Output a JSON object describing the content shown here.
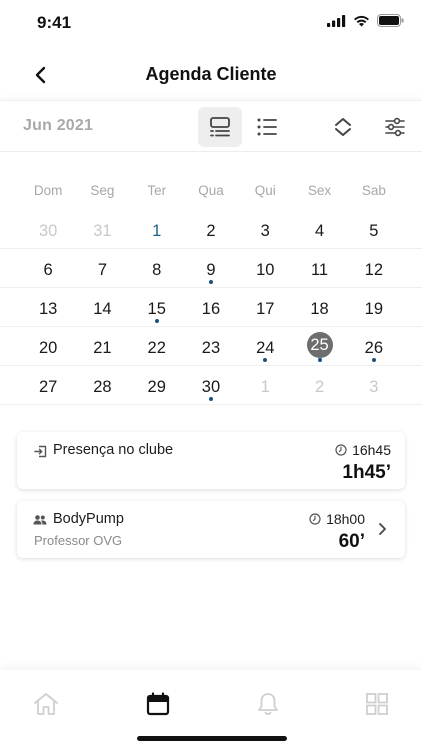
{
  "status_bar": {
    "time": "9:41"
  },
  "header": {
    "title": "Agenda Cliente",
    "back_icon": "chevron-left-icon"
  },
  "toolbar": {
    "month": "Jun 2021",
    "view_modes": [
      "calendar-grid-icon",
      "list-icon"
    ],
    "active_view": "calendar-grid-icon",
    "actions": [
      "collapse-icon",
      "filter-icon"
    ]
  },
  "calendar": {
    "weekdays": [
      "Dom",
      "Seg",
      "Ter",
      "Qua",
      "Qui",
      "Sex",
      "Sab"
    ],
    "weeks": [
      [
        {
          "d": "30",
          "muted": true
        },
        {
          "d": "31",
          "muted": true
        },
        {
          "d": "1",
          "today": true
        },
        {
          "d": "2"
        },
        {
          "d": "3"
        },
        {
          "d": "4"
        },
        {
          "d": "5"
        }
      ],
      [
        {
          "d": "6"
        },
        {
          "d": "7"
        },
        {
          "d": "8"
        },
        {
          "d": "9",
          "dot": true
        },
        {
          "d": "10"
        },
        {
          "d": "11"
        },
        {
          "d": "12"
        }
      ],
      [
        {
          "d": "13"
        },
        {
          "d": "14"
        },
        {
          "d": "15",
          "dot": true
        },
        {
          "d": "16"
        },
        {
          "d": "17"
        },
        {
          "d": "18"
        },
        {
          "d": "19"
        }
      ],
      [
        {
          "d": "20"
        },
        {
          "d": "21"
        },
        {
          "d": "22"
        },
        {
          "d": "23"
        },
        {
          "d": "24",
          "dot": true
        },
        {
          "d": "25",
          "dot": true,
          "selected": true
        },
        {
          "d": "26",
          "dot": true
        }
      ],
      [
        {
          "d": "27"
        },
        {
          "d": "28"
        },
        {
          "d": "29"
        },
        {
          "d": "30",
          "dot": true
        },
        {
          "d": "1",
          "muted": true
        },
        {
          "d": "2",
          "muted": true
        },
        {
          "d": "3",
          "muted": true
        }
      ]
    ],
    "colors": {
      "today": "#1e5f8c",
      "selected_bg": "#6d6d6d",
      "dot": "#1d4f7a",
      "muted": "#c8c8c8"
    }
  },
  "events": [
    {
      "icon": "enter-door-icon",
      "title": "Presença no clube",
      "subtitle": "",
      "time": "16h45",
      "duration": "1h45’",
      "has_chevron": false
    },
    {
      "icon": "group-users-icon",
      "title": "BodyPump",
      "subtitle": "Professor OVG",
      "time": "18h00",
      "duration": "60’",
      "has_chevron": true
    }
  ],
  "tab_bar": {
    "items": [
      "home-icon",
      "calendar-icon",
      "bell-icon",
      "apps-grid-icon"
    ],
    "active": "calendar-icon"
  }
}
